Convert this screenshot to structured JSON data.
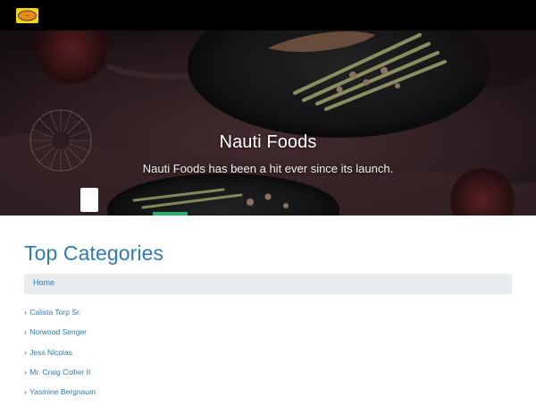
{
  "navbar": {
    "logo_icon": "brand-logo-icon",
    "background": "#000000"
  },
  "hero": {
    "title": "Nauti Foods",
    "subtitle": "Nauti Foods has been a hit ever since its launch.",
    "indicator_color": "#1fb36b"
  },
  "categories": {
    "heading": "Top Categories",
    "breadcrumb": {
      "home_label": "Home"
    },
    "items": [
      {
        "label": "Calista Torp Sr."
      },
      {
        "label": "Norwood Senger"
      },
      {
        "label": "Jess Nicolas"
      },
      {
        "label": "Mr. Craig Collier II"
      },
      {
        "label": "Yasmine Bergnaum"
      }
    ],
    "bullet_icon": "chevron-right-icon"
  },
  "colors": {
    "accent": "#2f7ab5",
    "breadcrumb_bg": "#e9ecef"
  }
}
